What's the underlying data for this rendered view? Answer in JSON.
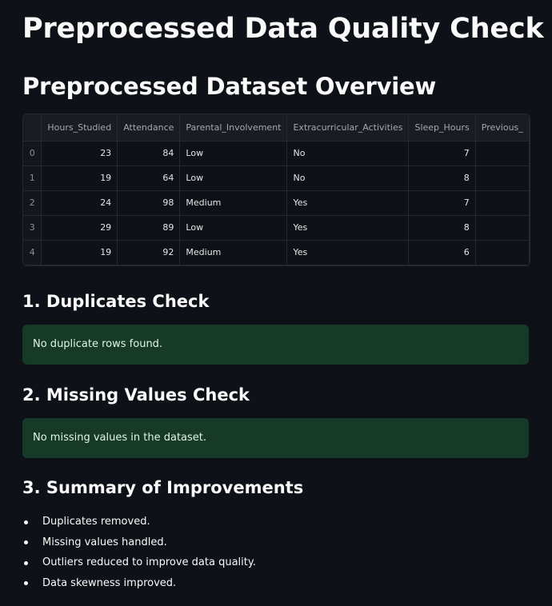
{
  "title": "Preprocessed Data Quality Check",
  "overview_heading": "Preprocessed Dataset Overview",
  "table": {
    "columns": [
      "Hours_Studied",
      "Attendance",
      "Parental_Involvement",
      "Extracurricular_Activities",
      "Sleep_Hours",
      "Previous_"
    ],
    "rows": [
      {
        "index": "0",
        "cells": [
          "23",
          "84",
          "Low",
          "No",
          "7",
          ""
        ]
      },
      {
        "index": "1",
        "cells": [
          "19",
          "64",
          "Low",
          "No",
          "8",
          ""
        ]
      },
      {
        "index": "2",
        "cells": [
          "24",
          "98",
          "Medium",
          "Yes",
          "7",
          ""
        ]
      },
      {
        "index": "3",
        "cells": [
          "29",
          "89",
          "Low",
          "Yes",
          "8",
          ""
        ]
      },
      {
        "index": "4",
        "cells": [
          "19",
          "92",
          "Medium",
          "Yes",
          "6",
          ""
        ]
      }
    ]
  },
  "duplicates": {
    "heading": "1. Duplicates Check",
    "message": "No duplicate rows found."
  },
  "missing": {
    "heading": "2. Missing Values Check",
    "message": "No missing values in the dataset."
  },
  "summary": {
    "heading": "3. Summary of Improvements",
    "items": [
      "Duplicates removed.",
      "Missing values handled.",
      "Outliers reduced to improve data quality.",
      "Data skewness improved."
    ]
  },
  "colors": {
    "background": "#0e1117",
    "success_bg": "#173928",
    "success_text": "#dff5e6"
  }
}
